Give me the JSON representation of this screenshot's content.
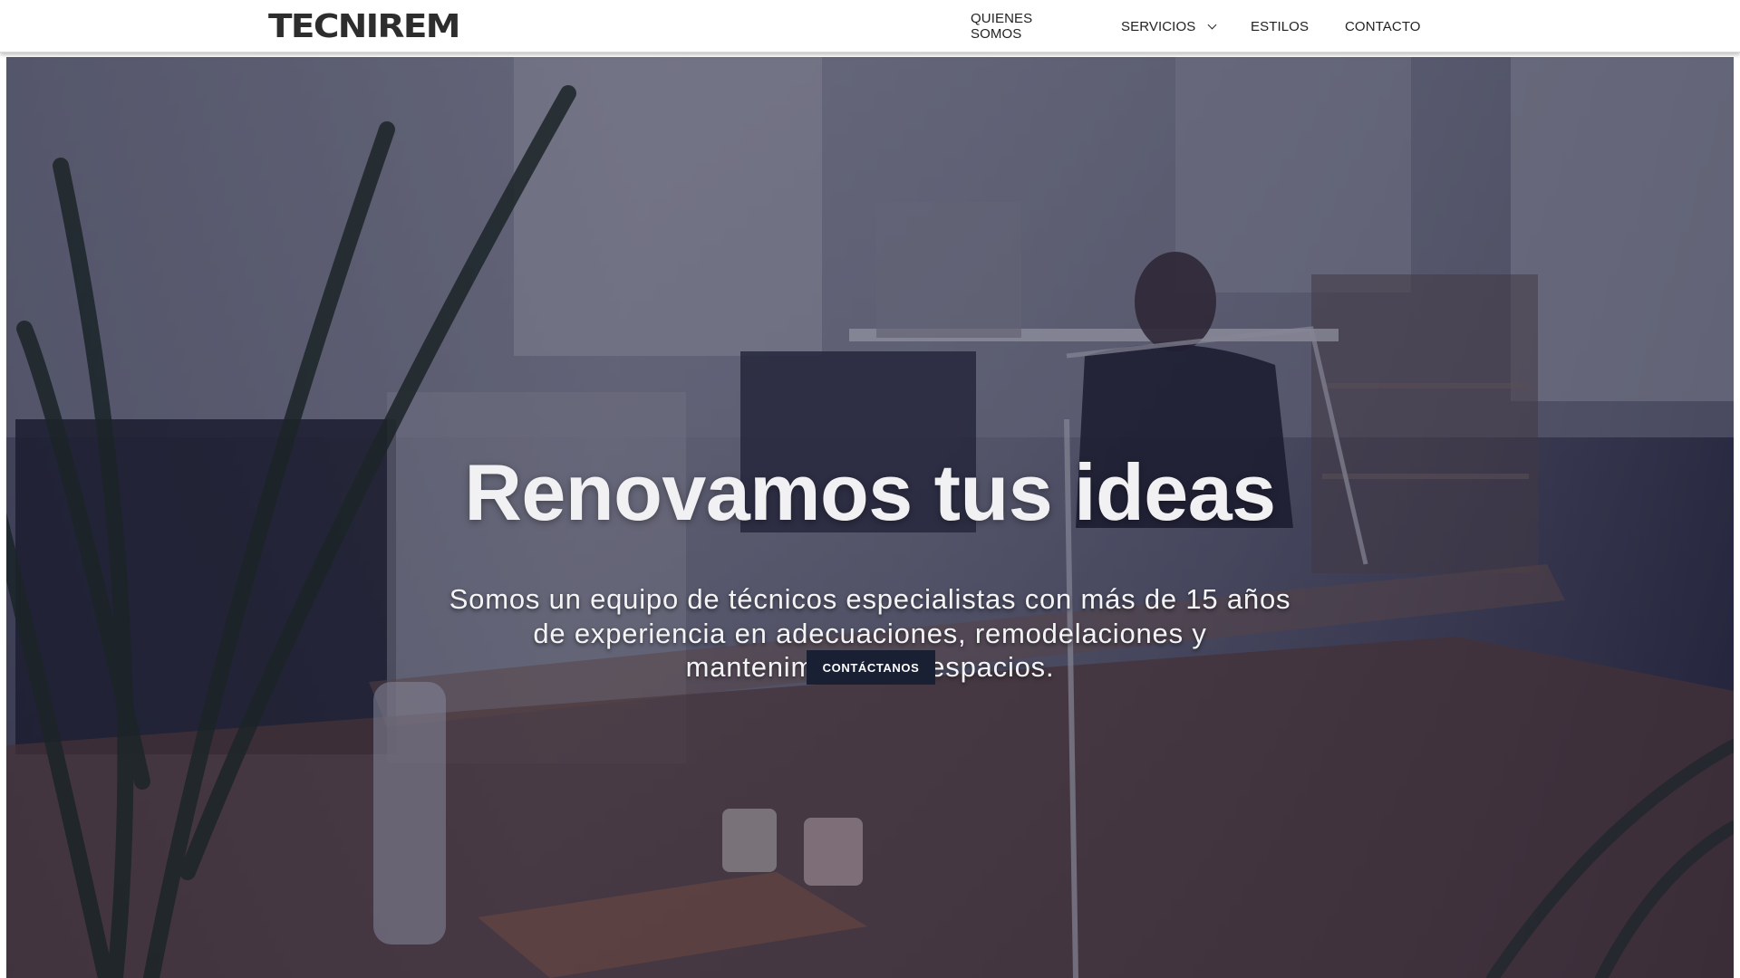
{
  "header": {
    "logo_text": "TECNIREM",
    "nav": [
      {
        "label": "QUIENES SOMOS"
      },
      {
        "label": "SERVICIOS",
        "has_dropdown": true,
        "icon": "chevron-down-icon"
      },
      {
        "label": "ESTILOS"
      },
      {
        "label": "CONTACTO"
      }
    ]
  },
  "hero": {
    "background_image": "office-workspace-photo",
    "title": "Renovamos tus ideas",
    "subtitle": "Somos un equipo de técnicos especialistas con más de 15 años de experiencia en adecuaciones, remodelaciones y mantenimiento de espacios.",
    "cta_label": "Contáctanos",
    "cta_color": "#1a2034",
    "overlay_color": "#1c1e3c"
  }
}
